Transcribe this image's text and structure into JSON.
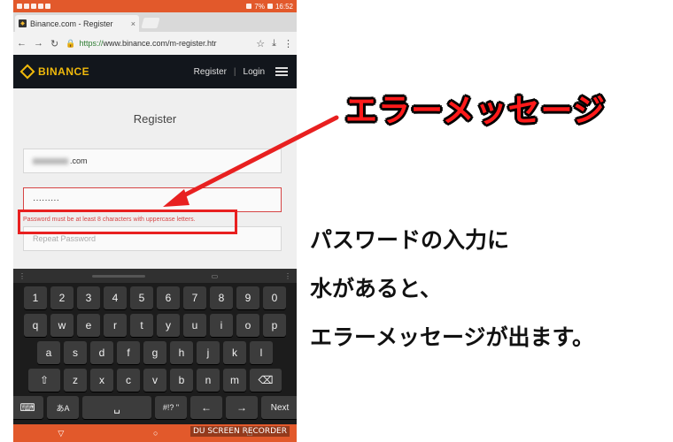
{
  "status_bar": {
    "battery": "7%",
    "time": "16:52"
  },
  "browser": {
    "tab_title": "Binance.com - Register",
    "tab_close": "×",
    "url_scheme": "https://",
    "url_host": "www.binance.com",
    "url_path": "/m-register.htr"
  },
  "site": {
    "logo": "BINANCE",
    "nav_register": "Register",
    "nav_separator": "|",
    "nav_login": "Login"
  },
  "form": {
    "title": "Register",
    "email_suffix": ".com",
    "password_value": "·········",
    "error_message": "Password must be at least 8 characters with uppercase letters.",
    "repeat_placeholder": "Repeat Password"
  },
  "keyboard": {
    "row_numbers": [
      "1",
      "2",
      "3",
      "4",
      "5",
      "6",
      "7",
      "8",
      "9",
      "0"
    ],
    "row_top": [
      "q",
      "w",
      "e",
      "r",
      "t",
      "y",
      "u",
      "i",
      "o",
      "p"
    ],
    "row_mid": [
      "a",
      "s",
      "d",
      "f",
      "g",
      "h",
      "j",
      "k",
      "l"
    ],
    "row_bottom": [
      "z",
      "x",
      "c",
      "v",
      "b",
      "n",
      "m"
    ],
    "shift": "⇧",
    "backspace": "⌫",
    "emoji": "⌨",
    "lang": "あA",
    "space": "␣",
    "symbols": "#!? \"",
    "left": "←",
    "right": "→",
    "next": "Next"
  },
  "nav_bar": {
    "watermark": "DU SCREEN RECORDER"
  },
  "annotation": {
    "callout": "エラーメッセージ",
    "line1": "パスワードの入力に",
    "line2": "水があると、",
    "line3": "エラーメッセージが出ます。"
  },
  "colors": {
    "status_bar": "#e2592b",
    "brand": "#f0b90b",
    "error": "#d64545",
    "highlight": "#e82020"
  }
}
